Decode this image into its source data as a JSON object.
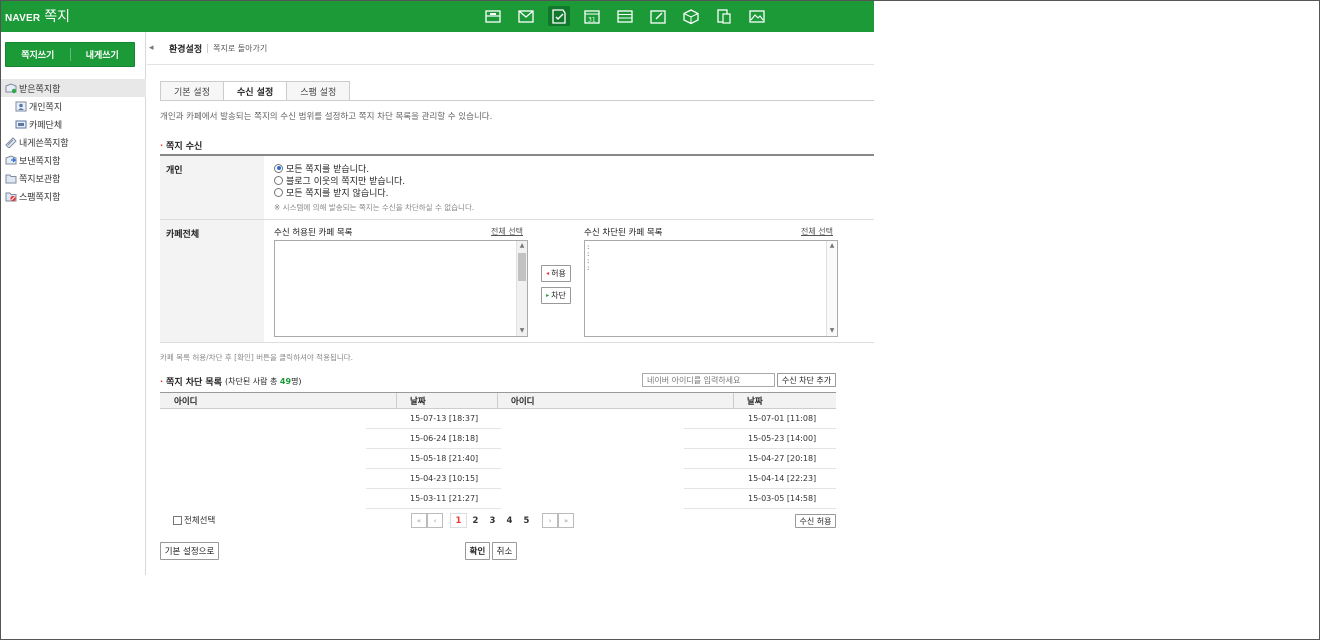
{
  "header": {
    "brand": "NAVER",
    "app_name": "쪽지",
    "icons": [
      "mail-box-icon",
      "mail-icon",
      "note-icon",
      "calendar-icon",
      "list-icon",
      "memo-icon",
      "cube-icon",
      "document-icon",
      "photo-icon"
    ]
  },
  "sidebar": {
    "compose_label": "쪽지쓰기",
    "self_compose_label": "내게쓰기",
    "folders": [
      {
        "label": "받은쪽지함"
      },
      {
        "label": "개인쪽지"
      },
      {
        "label": "카페단체"
      },
      {
        "label": "내게쓴쪽지함"
      },
      {
        "label": "보낸쪽지함"
      },
      {
        "label": "쪽지보관함"
      },
      {
        "label": "스팸쪽지함"
      }
    ]
  },
  "breadcrumb": {
    "title": "환경설정",
    "back_link": "쪽지로 돌아가기"
  },
  "tabs": [
    {
      "label": "기본 설정"
    },
    {
      "label": "수신 설정"
    },
    {
      "label": "스팸 설정"
    }
  ],
  "description": "개인과 카페에서 발송되는 쪽지의 수신 범위를 설정하고 쪽지 차단 목록을 관리할 수 있습니다.",
  "receive_section": {
    "title": "쪽지 수신",
    "personal": {
      "label": "개인",
      "options": [
        {
          "label": "모든 쪽지를 받습니다.",
          "checked": true
        },
        {
          "label": "블로그 이웃의 쪽지만 받습니다.",
          "checked": false
        },
        {
          "label": "모든 쪽지를 받지 않습니다.",
          "checked": false
        }
      ],
      "note": "※ 시스템에 의해 발송되는 쪽지는 수신을 차단하실 수 없습니다."
    },
    "cafe": {
      "label": "카페전체",
      "allowed_title": "수신 허용된 카페 목록",
      "blocked_title": "수신 차단된 카페 목록",
      "select_all": "전체 선택",
      "allow_button": "허용",
      "block_button": "차단"
    }
  },
  "apply_note": "카페 목록 허용/차단 후 [확인] 버튼을 클릭하셔야 적용됩니다.",
  "block_section": {
    "title": "쪽지 차단 목록",
    "count_prefix": "(차단된 사람 총 ",
    "count": "49",
    "count_suffix": "명)",
    "input_placeholder": "네이버 아이디를 입력하세요",
    "add_button": "수신 차단 추가",
    "columns": [
      "아이디",
      "날짜",
      "아이디",
      "날짜"
    ],
    "rows": [
      [
        "",
        "15-07-13 [18:37]",
        "",
        "15-07-01 [11:08]"
      ],
      [
        "",
        "15-06-24 [18:18]",
        "",
        "15-05-23 [14:00]"
      ],
      [
        "",
        "15-05-18 [21:40]",
        "",
        "15-04-27 [20:18]"
      ],
      [
        "",
        "15-04-23 [10:15]",
        "",
        "15-04-14 [22:23]"
      ],
      [
        "",
        "15-03-11 [21:27]",
        "",
        "15-03-05 [14:58]"
      ]
    ],
    "select_all": "전체선택",
    "pages": [
      "1",
      "2",
      "3",
      "4",
      "5"
    ],
    "current_page": "1",
    "allow_button": "수신 허용"
  },
  "footer": {
    "reset_button": "기본 설정으로",
    "confirm_button": "확인",
    "cancel_button": "취소"
  },
  "colors": {
    "brand_green": "#1b9a37",
    "accent_red": "#e33333"
  }
}
